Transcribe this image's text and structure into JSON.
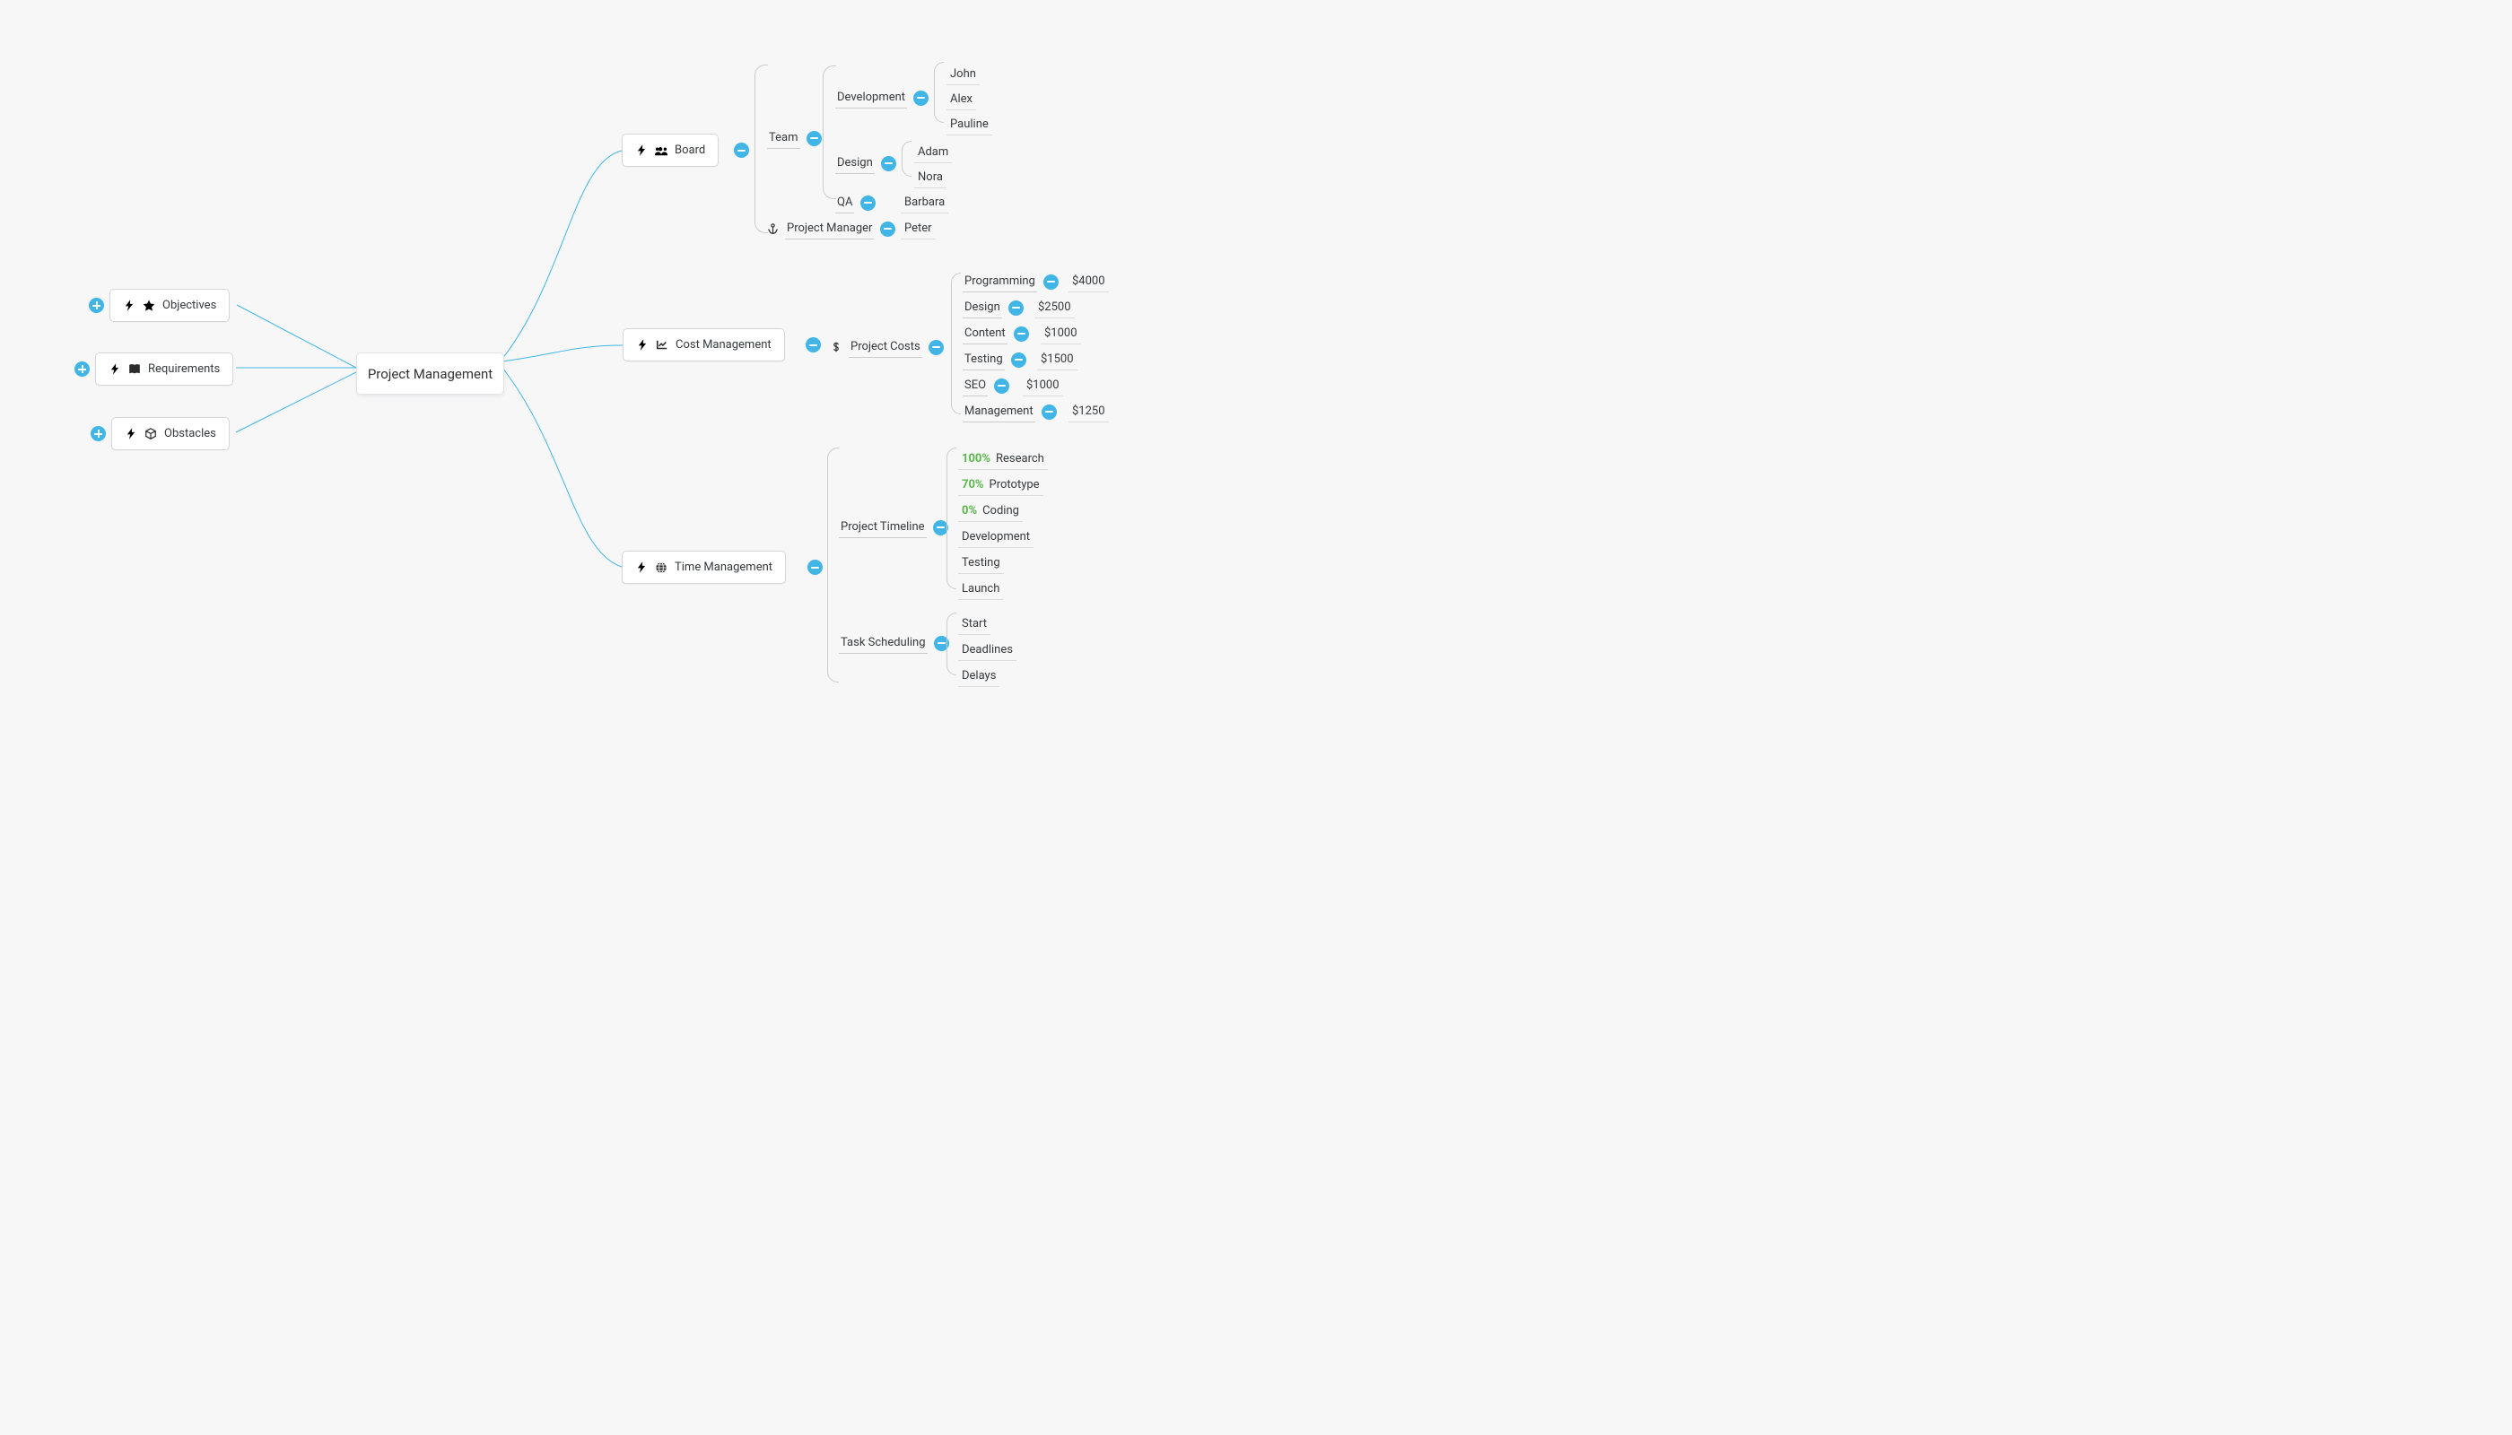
{
  "root": {
    "label": "Project Management"
  },
  "left": {
    "objectives": {
      "label": "Objectives"
    },
    "requirements": {
      "label": "Requirements"
    },
    "obstacles": {
      "label": "Obstacles"
    }
  },
  "right": {
    "board": {
      "label": "Board",
      "team": {
        "label": "Team",
        "development": {
          "label": "Development",
          "members": [
            "John",
            "Alex",
            "Pauline"
          ]
        },
        "design": {
          "label": "Design",
          "members": [
            "Adam",
            "Nora"
          ]
        },
        "qa": {
          "label": "QA",
          "members": [
            "Barbara"
          ]
        }
      },
      "pm": {
        "label": "Project Manager",
        "name": "Peter"
      }
    },
    "cost": {
      "label": "Cost Management",
      "project_costs": {
        "label": "Project Costs",
        "items": [
          {
            "name": "Programming",
            "value": "$4000"
          },
          {
            "name": "Design",
            "value": "$2500"
          },
          {
            "name": "Content",
            "value": "$1000"
          },
          {
            "name": "Testing",
            "value": "$1500"
          },
          {
            "name": "SEO",
            "value": "$1000"
          },
          {
            "name": "Management",
            "value": "$1250"
          }
        ]
      }
    },
    "time": {
      "label": "Time Management",
      "timeline": {
        "label": "Project Timeline",
        "items": [
          {
            "pct": "100%",
            "name": "Research"
          },
          {
            "pct": "70%",
            "name": "Prototype"
          },
          {
            "pct": "0%",
            "name": "Coding"
          },
          {
            "pct": "",
            "name": "Development"
          },
          {
            "pct": "",
            "name": "Testing"
          },
          {
            "pct": "",
            "name": "Launch"
          }
        ]
      },
      "scheduling": {
        "label": "Task Scheduling",
        "items": [
          "Start",
          "Deadlines",
          "Delays"
        ]
      }
    }
  }
}
